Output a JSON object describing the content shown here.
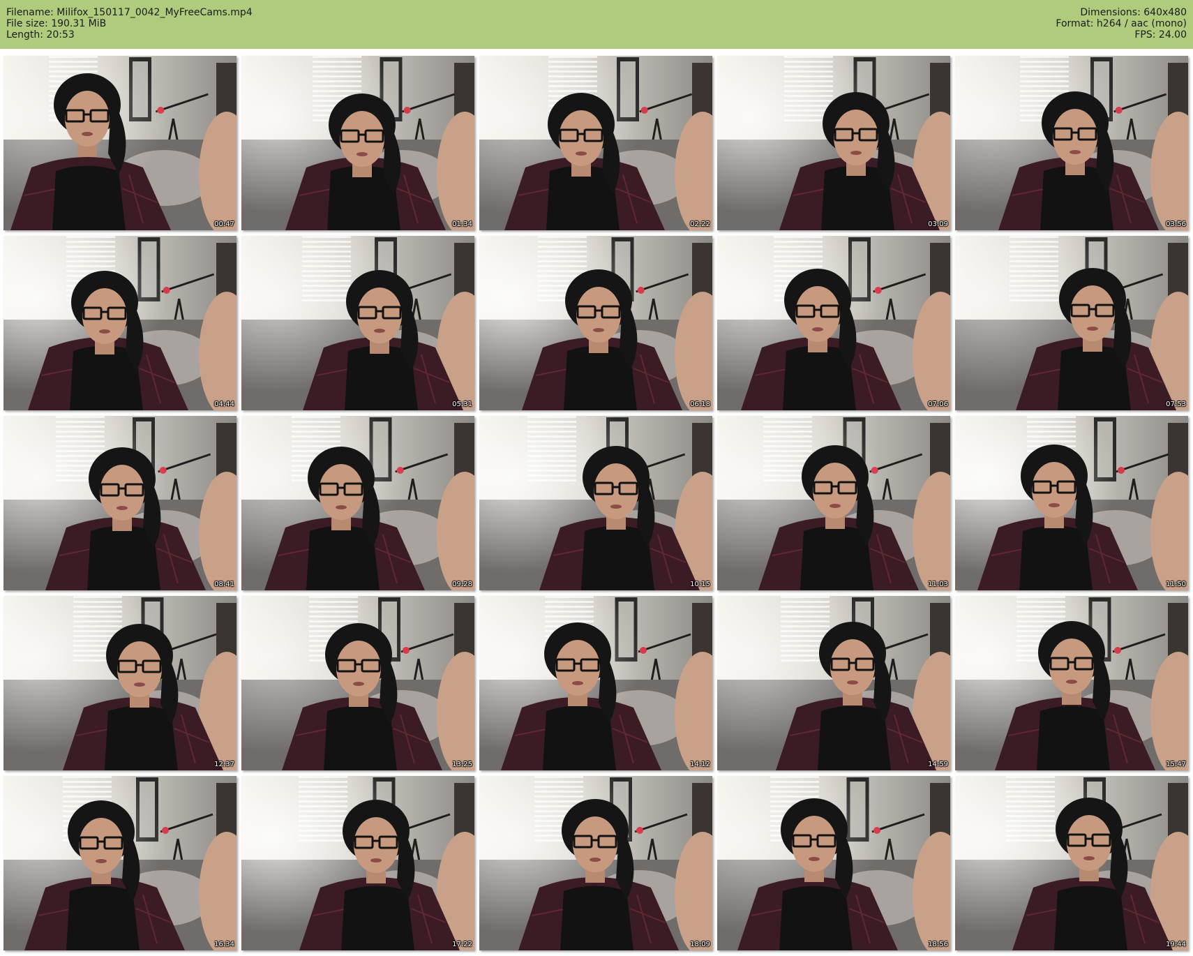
{
  "header": {
    "filename_line": "Filename: Milifox_150117_0042_MyFreeCams.mp4",
    "filesize_line": "File size: 190.31 MiB",
    "length_line": "Length: 20:53",
    "dimensions_line": "Dimensions: 640x480",
    "format_line": "Format: h264 / aac (mono)",
    "fps_line": "FPS: 24.00"
  },
  "colors": {
    "header_bg": "#afcc7d",
    "page_bg": "#ffffff"
  },
  "thumbnails": [
    {
      "time": "00:47"
    },
    {
      "time": "01:34"
    },
    {
      "time": "02:22"
    },
    {
      "time": "03:09"
    },
    {
      "time": "03:56"
    },
    {
      "time": "04:44"
    },
    {
      "time": "05:31"
    },
    {
      "time": "06:18"
    },
    {
      "time": "07:06"
    },
    {
      "time": "07:53"
    },
    {
      "time": "08:41"
    },
    {
      "time": "09:28"
    },
    {
      "time": "10:15"
    },
    {
      "time": "11:03"
    },
    {
      "time": "11:50"
    },
    {
      "time": "12:37"
    },
    {
      "time": "13:25"
    },
    {
      "time": "14:12"
    },
    {
      "time": "14:59"
    },
    {
      "time": "15:47"
    },
    {
      "time": "16:34"
    },
    {
      "time": "17:22"
    },
    {
      "time": "18:09"
    },
    {
      "time": "18:56"
    },
    {
      "time": "19:44"
    }
  ]
}
